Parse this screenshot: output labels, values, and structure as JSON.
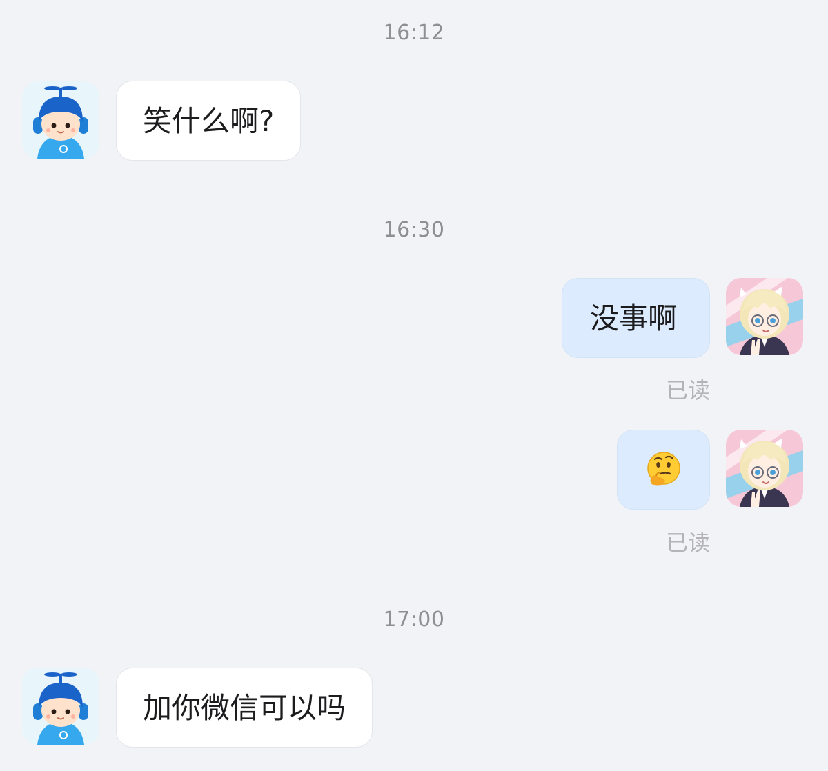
{
  "conversation": {
    "timestamps": [
      "16:12",
      "16:30",
      "17:00"
    ],
    "messages": [
      {
        "from": "other",
        "text": "笑什么啊?"
      },
      {
        "from": "self",
        "text": "没事啊",
        "status": "已读"
      },
      {
        "from": "self",
        "emoji": "thinking-face",
        "status": "已读"
      },
      {
        "from": "other",
        "text": "加你微信可以吗"
      }
    ]
  },
  "colors": {
    "background": "#f2f3f7",
    "incoming_bubble": "#ffffff",
    "outgoing_bubble": "#dcebfd",
    "timestamp_text": "#8e8e94",
    "read_text": "#b3b3b8"
  },
  "icons": {
    "contact_avatar": "propeller-cap-boy-avatar",
    "self_avatar": "anime-girl-avatar",
    "emoji": "thinking-face-emoji"
  }
}
